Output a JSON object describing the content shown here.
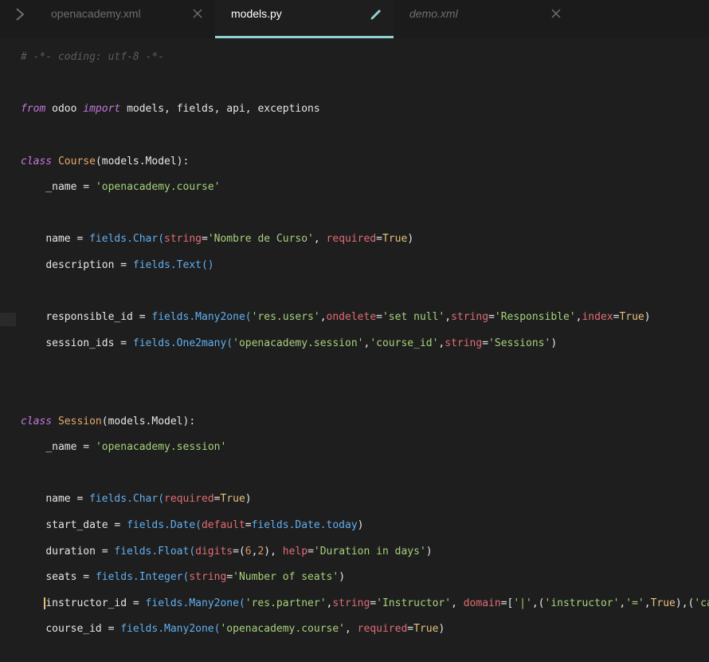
{
  "tabs": [
    {
      "label": "openacademy.xml",
      "active": false
    },
    {
      "label": "models.py",
      "active": true,
      "modified": true
    },
    {
      "label": "demo.xml",
      "active": false
    }
  ],
  "colors": {
    "background": "#1e1e1e",
    "active_tab_underline": "#8fd3d0",
    "keyword": "#c678dd",
    "string": "#a6d17b",
    "function": "#61afef"
  },
  "code": {
    "line1": "# -*- coding: utf-8 -*-",
    "line2_kw1": "from",
    "line2_mod": "odoo",
    "line2_kw2": "import",
    "line2_rest": "models, fields, api, exceptions",
    "class1_kw": "class",
    "class1_name": "Course",
    "class1_base": "(models.Model):",
    "c1_name_attr": "_name = ",
    "c1_name_val": "'openacademy.course'",
    "c1_l1_lhs": "name = ",
    "c1_l1_fn": "fields.Char(",
    "c1_l1_arg1": "string",
    "c1_l1_val1": "'Nombre de Curso'",
    "c1_l1_sep": ", ",
    "c1_l1_arg2": "required",
    "c1_l1_val2": "True",
    "c1_l1_end": ")",
    "c1_l2_lhs": "description = ",
    "c1_l2_fn": "fields.Text()",
    "c1_l3_lhs": "responsible_id = ",
    "c1_l3_fn": "fields.Many2one(",
    "c1_l3_s1": "'res.users'",
    "c1_l3_a1": "ondelete",
    "c1_l3_s2": "'set null'",
    "c1_l3_a2": "string",
    "c1_l3_s3": "'Responsible'",
    "c1_l3_a3": "index",
    "c1_l3_v": "True",
    "c1_l4_lhs": "session_ids = ",
    "c1_l4_fn": "fields.One2many(",
    "c1_l4_s1": "'openacademy.session'",
    "c1_l4_s2": "'course_id'",
    "c1_l4_a1": "string",
    "c1_l4_s3": "'Sessions'",
    "class2_kw": "class",
    "class2_name": "Session",
    "class2_base": "(models.Model):",
    "c2_name_attr": "_name = ",
    "c2_name_val": "'openacademy.session'",
    "c2_l1_lhs": "name = ",
    "c2_l1_fn": "fields.Char(",
    "c2_l1_a1": "required",
    "c2_l1_v": "True",
    "c2_l2_lhs": "start_date = ",
    "c2_l2_fn": "fields.Date(",
    "c2_l2_a1": "default",
    "c2_l2_v": "fields.Date.today",
    "c2_l3_lhs": "duration = ",
    "c2_l3_fn": "fields.Float(",
    "c2_l3_a1": "digits",
    "c2_l3_n1": "6",
    "c2_l3_n2": "2",
    "c2_l3_a2": "help",
    "c2_l3_s1": "'Duration in days'",
    "c2_l4_lhs": "seats = ",
    "c2_l4_fn": "fields.Integer(",
    "c2_l4_a1": "string",
    "c2_l4_s1": "'Number of seats'",
    "c2_l5_lhs": "instructor_id = ",
    "c2_l5_fn": "fields.Many2one(",
    "c2_l5_s1": "'res.partner'",
    "c2_l5_a1": "string",
    "c2_l5_s2": "'Instructor'",
    "c2_l5_a2": "domain",
    "c2_l5_s3": "'|'",
    "c2_l5_s4": "'instructor'",
    "c2_l5_s5": "'='",
    "c2_l5_v": "True",
    "c2_l5_s6": "'categ",
    "c2_l6_lhs": "course_id = ",
    "c2_l6_fn": "fields.Many2one(",
    "c2_l6_s1": "'openacademy.course'",
    "c2_l6_a1": "required",
    "c2_l6_v": "True"
  }
}
